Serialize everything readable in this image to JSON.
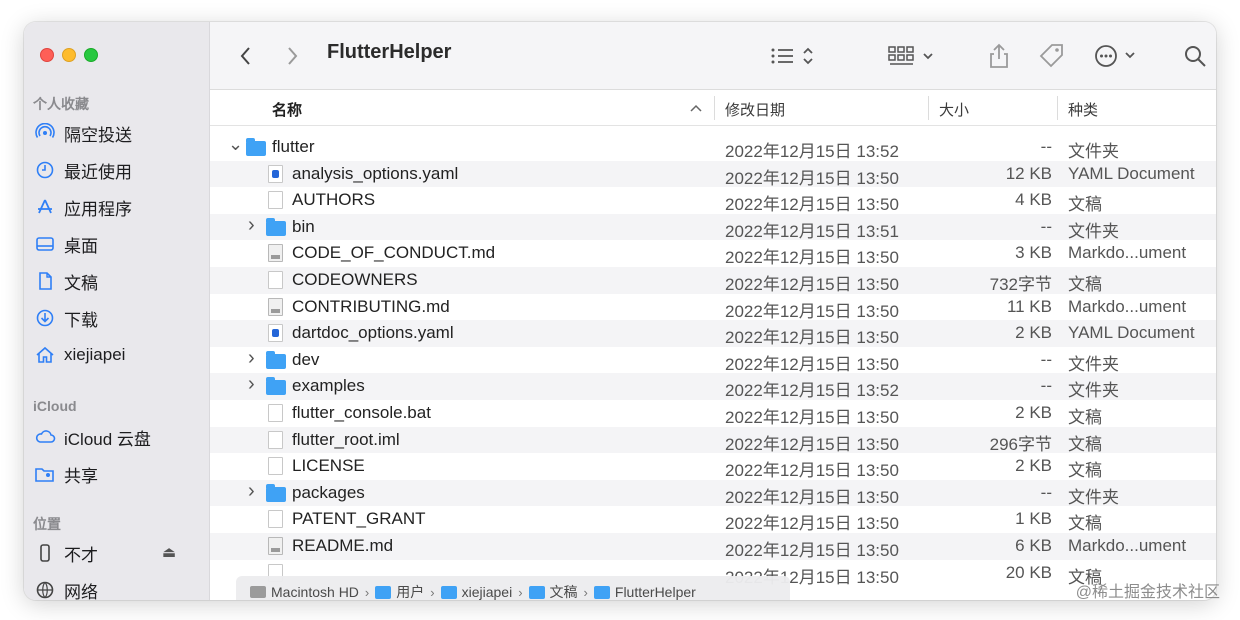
{
  "window": {
    "title": "FlutterHelper"
  },
  "sidebar": {
    "sections": [
      {
        "label": "个人收藏"
      },
      {
        "label": "iCloud"
      },
      {
        "label": "位置"
      }
    ],
    "favorites": [
      {
        "label": "隔空投送",
        "icon": "airdrop-icon"
      },
      {
        "label": "最近使用",
        "icon": "clock-icon"
      },
      {
        "label": "应用程序",
        "icon": "applications-icon"
      },
      {
        "label": "桌面",
        "icon": "desktop-icon"
      },
      {
        "label": "文稿",
        "icon": "document-icon"
      },
      {
        "label": "下载",
        "icon": "download-icon"
      },
      {
        "label": "xiejiapei",
        "icon": "home-icon"
      }
    ],
    "icloud": [
      {
        "label": "iCloud 云盘",
        "icon": "cloud-icon"
      },
      {
        "label": "共享",
        "icon": "shared-folder-icon"
      }
    ],
    "locations": [
      {
        "label": "不才",
        "icon": "phone-icon"
      },
      {
        "label": "网络",
        "icon": "network-icon"
      }
    ]
  },
  "columns": {
    "name": "名称",
    "date": "修改日期",
    "size": "大小",
    "kind": "种类"
  },
  "files": [
    {
      "name": "flutter",
      "date": "2022年12月15日 13:52",
      "size": "--",
      "kind": "文件夹",
      "type": "folder",
      "disclosure": "expanded",
      "depth": 0
    },
    {
      "name": "analysis_options.yaml",
      "date": "2022年12月15日 13:50",
      "size": "12 KB",
      "kind": "YAML Document",
      "type": "yaml",
      "depth": 1
    },
    {
      "name": "AUTHORS",
      "date": "2022年12月15日 13:50",
      "size": "4 KB",
      "kind": "文稿",
      "type": "doc",
      "depth": 1
    },
    {
      "name": "bin",
      "date": "2022年12月15日 13:51",
      "size": "--",
      "kind": "文件夹",
      "type": "folder",
      "disclosure": "collapsed",
      "depth": 1
    },
    {
      "name": "CODE_OF_CONDUCT.md",
      "date": "2022年12月15日 13:50",
      "size": "3 KB",
      "kind": "Markdo...ument",
      "type": "md",
      "depth": 1
    },
    {
      "name": "CODEOWNERS",
      "date": "2022年12月15日 13:50",
      "size": "732字节",
      "kind": "文稿",
      "type": "doc",
      "depth": 1
    },
    {
      "name": "CONTRIBUTING.md",
      "date": "2022年12月15日 13:50",
      "size": "11 KB",
      "kind": "Markdo...ument",
      "type": "md",
      "depth": 1
    },
    {
      "name": "dartdoc_options.yaml",
      "date": "2022年12月15日 13:50",
      "size": "2 KB",
      "kind": "YAML Document",
      "type": "yaml",
      "depth": 1
    },
    {
      "name": "dev",
      "date": "2022年12月15日 13:50",
      "size": "--",
      "kind": "文件夹",
      "type": "folder",
      "disclosure": "collapsed",
      "depth": 1
    },
    {
      "name": "examples",
      "date": "2022年12月15日 13:52",
      "size": "--",
      "kind": "文件夹",
      "type": "folder",
      "disclosure": "collapsed",
      "depth": 1
    },
    {
      "name": "flutter_console.bat",
      "date": "2022年12月15日 13:50",
      "size": "2 KB",
      "kind": "文稿",
      "type": "doc",
      "depth": 1
    },
    {
      "name": "flutter_root.iml",
      "date": "2022年12月15日 13:50",
      "size": "296字节",
      "kind": "文稿",
      "type": "doc",
      "depth": 1
    },
    {
      "name": "LICENSE",
      "date": "2022年12月15日 13:50",
      "size": "2 KB",
      "kind": "文稿",
      "type": "doc",
      "depth": 1
    },
    {
      "name": "packages",
      "date": "2022年12月15日 13:50",
      "size": "--",
      "kind": "文件夹",
      "type": "folder",
      "disclosure": "collapsed",
      "depth": 1
    },
    {
      "name": "PATENT_GRANT",
      "date": "2022年12月15日 13:50",
      "size": "1 KB",
      "kind": "文稿",
      "type": "doc",
      "depth": 1
    },
    {
      "name": "README.md",
      "date": "2022年12月15日 13:50",
      "size": "6 KB",
      "kind": "Markdo...ument",
      "type": "md",
      "depth": 1
    },
    {
      "name": "",
      "date": "2022年12月15日 13:50",
      "size": "20 KB",
      "kind": "文稿",
      "type": "doc",
      "depth": 1
    }
  ],
  "pathbar": [
    {
      "label": "Macintosh HD",
      "icon": "disk-icon"
    },
    {
      "label": "用户",
      "icon": "folder-icon"
    },
    {
      "label": "xiejiapei",
      "icon": "home-folder-icon"
    },
    {
      "label": "文稿",
      "icon": "documents-folder-icon"
    },
    {
      "label": "FlutterHelper",
      "icon": "folder-icon"
    }
  ],
  "watermark": "@稀土掘金技术社区"
}
